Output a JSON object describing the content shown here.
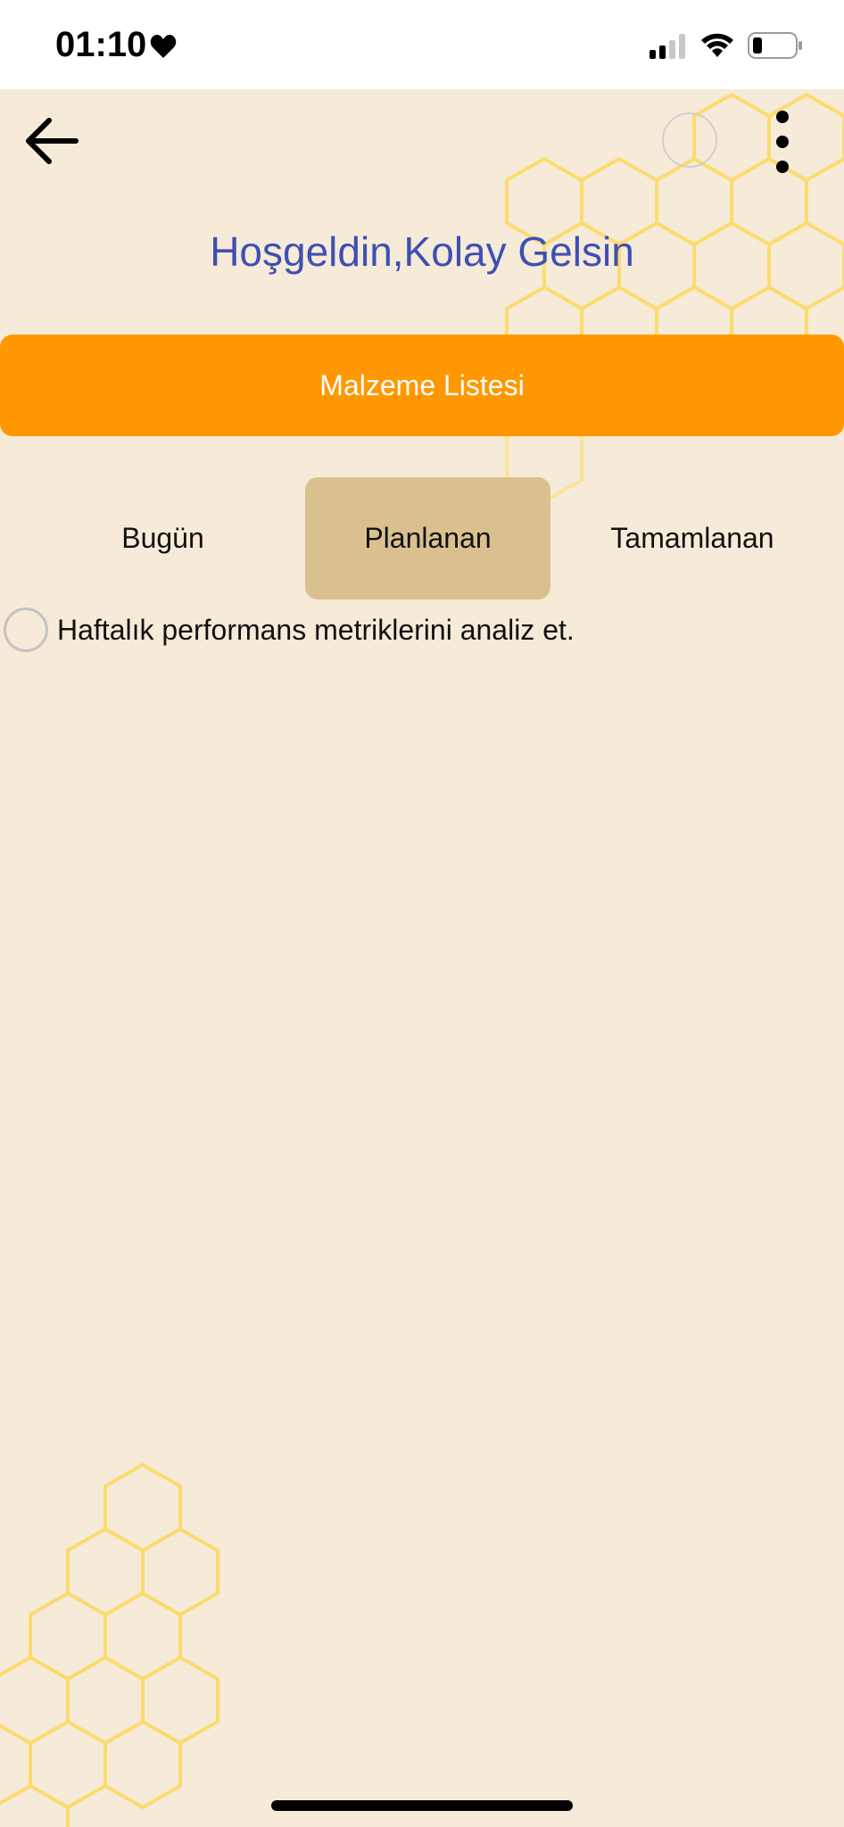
{
  "status_bar": {
    "time": "01:10",
    "icons": [
      "heart-icon",
      "cellular-signal-icon",
      "wifi-icon",
      "battery-icon"
    ]
  },
  "header": {
    "back_icon": "arrow-left-icon",
    "menu_icon": "more-vertical-icon"
  },
  "welcome": {
    "title": "Hoşgeldin,Kolay Gelsin"
  },
  "primary_action": {
    "label": "Malzeme Listesi"
  },
  "tabs": [
    {
      "label": "Bugün",
      "selected": false
    },
    {
      "label": "Planlanan",
      "selected": true
    },
    {
      "label": "Tamamlanan",
      "selected": false
    }
  ],
  "tasks": [
    {
      "label": "Haftalık performans metriklerini analiz et.",
      "done": false
    }
  ],
  "colors": {
    "background": "#f6ebd8",
    "accent": "#ff9800",
    "title": "#3f4fb4",
    "selected_tab": "#dbc08f",
    "honeycomb": "#fdd85d"
  }
}
